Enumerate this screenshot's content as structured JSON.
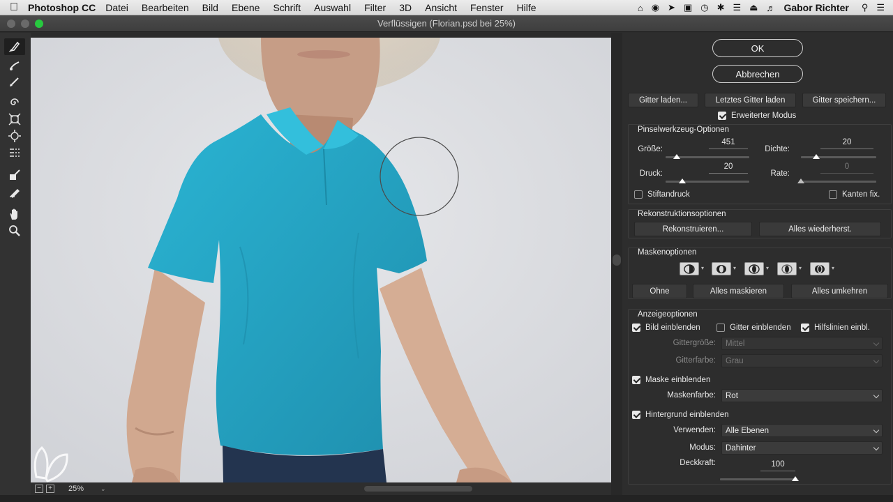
{
  "menubar": {
    "app_name": "Photoshop CC",
    "menus": [
      "Datei",
      "Bearbeiten",
      "Bild",
      "Ebene",
      "Schrift",
      "Auswahl",
      "Filter",
      "3D",
      "Ansicht",
      "Fenster",
      "Hilfe"
    ],
    "user": "Gabor Richter"
  },
  "window": {
    "title": "Verflüssigen (Florian.psd bei 25%)"
  },
  "tools": [
    "forward-warp-tool",
    "reconstruct-tool",
    "smooth-tool",
    "twirl-tool",
    "pucker-tool",
    "bloat-tool",
    "push-left-tool",
    "freeze-mask-tool",
    "thaw-mask-tool",
    "hand-tool",
    "zoom-tool"
  ],
  "status": {
    "zoom": "25%"
  },
  "buttons": {
    "ok": "OK",
    "cancel": "Abbrechen"
  },
  "mesh": {
    "load": "Gitter laden...",
    "load_last": "Letztes Gitter laden",
    "save": "Gitter speichern...",
    "advanced_mode": "Erweiterter Modus",
    "advanced_mode_checked": true
  },
  "brush": {
    "title": "Pinselwerkzeug-Optionen",
    "size_label": "Größe:",
    "size": "451",
    "size_pct": 0.13,
    "density_label": "Dichte:",
    "density": "20",
    "density_pct": 0.2,
    "pressure_label": "Druck:",
    "pressure": "20",
    "pressure_pct": 0.2,
    "rate_label": "Rate:",
    "rate": "0",
    "rate_pct": 0.0,
    "stylus_label": "Stiftandruck",
    "stylus_checked": false,
    "pin_edges_label": "Kanten fix.",
    "pin_edges_checked": false
  },
  "reconstruct": {
    "title": "Rekonstruktionsoptionen",
    "reconstruct_btn": "Rekonstruieren...",
    "restore_all_btn": "Alles wiederherst."
  },
  "mask": {
    "title": "Maskenoptionen",
    "none_btn": "Ohne",
    "mask_all_btn": "Alles maskieren",
    "invert_all_btn": "Alles umkehren"
  },
  "view": {
    "title": "Anzeigeoptionen",
    "show_image": "Bild einblenden",
    "show_image_checked": true,
    "show_mesh": "Gitter einblenden",
    "show_mesh_checked": false,
    "show_guides": "Hilfslinien einbl.",
    "show_guides_checked": true,
    "mesh_size_label": "Gittergröße:",
    "mesh_size_value": "Mittel",
    "mesh_color_label": "Gitterfarbe:",
    "mesh_color_value": "Grau",
    "show_mask": "Maske einblenden",
    "show_mask_checked": true,
    "mask_color_label": "Maskenfarbe:",
    "mask_color_value": "Rot",
    "show_backdrop": "Hintergrund einblenden",
    "show_backdrop_checked": true,
    "use_label": "Verwenden:",
    "use_value": "Alle Ebenen",
    "mode_label": "Modus:",
    "mode_value": "Dahinter",
    "opacity_label": "Deckkraft:",
    "opacity": "100",
    "opacity_pct": 1.0
  },
  "colors": {
    "shirt": "#29a8c5",
    "panel": "#2d2d2d",
    "canvas_bg": "#d9dbde"
  }
}
